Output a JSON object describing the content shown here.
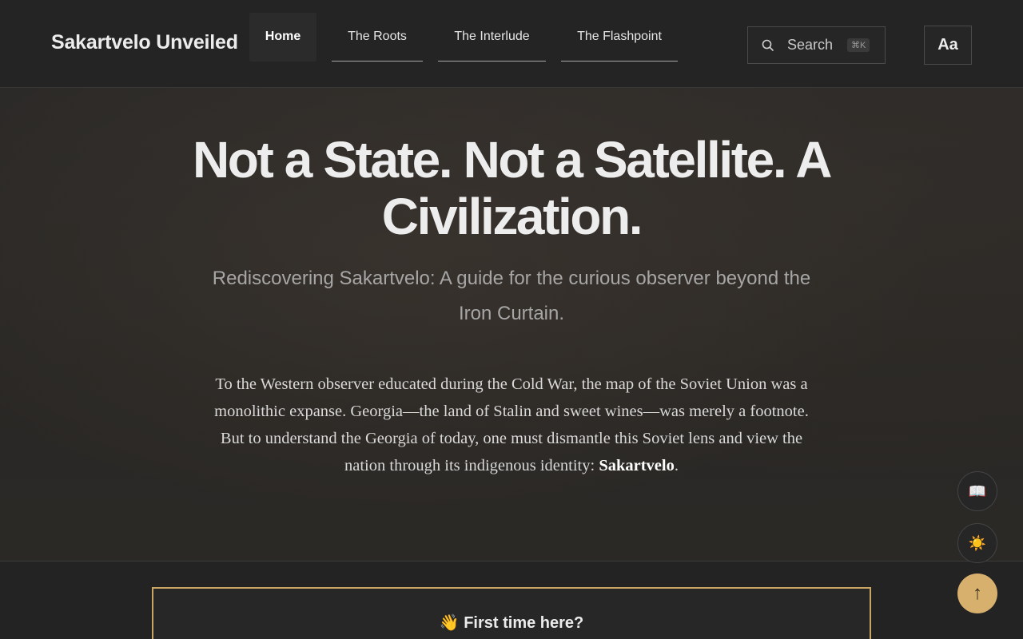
{
  "site": {
    "logo": "Sakartvelo Unveiled"
  },
  "nav": {
    "items": [
      {
        "label": "Home",
        "active": true
      },
      {
        "label": "The Roots",
        "active": false
      },
      {
        "label": "The Interlude",
        "active": false
      },
      {
        "label": "The Flashpoint",
        "active": false
      }
    ]
  },
  "search": {
    "placeholder": "Search",
    "shortcut": "⌘K",
    "icon": "search-icon"
  },
  "font_toggle": {
    "label": "Aa"
  },
  "hero": {
    "title": "Not a State. Not a Satellite. A Civilization.",
    "subtitle": "Rediscovering Sakartvelo: A guide for the curious observer beyond the Iron Curtain.",
    "body_text": "To the Western observer educated during the Cold War, the map of the Soviet Union was a monolithic expanse. Georgia—the land of Stalin and sweet wines—was merely a footnote. But to understand the Georgia of today, one must dismantle this Soviet lens and view the nation through its indigenous identity: ",
    "body_emphasis": "Sakartvelo",
    "body_end": "."
  },
  "fabs": {
    "reading_icon": "📖",
    "theme_icon": "☀️",
    "top_icon": "↑"
  },
  "welcome": {
    "title": "👋 First time here?"
  },
  "colors": {
    "accent": "#d8b06d",
    "background": "#232323"
  }
}
